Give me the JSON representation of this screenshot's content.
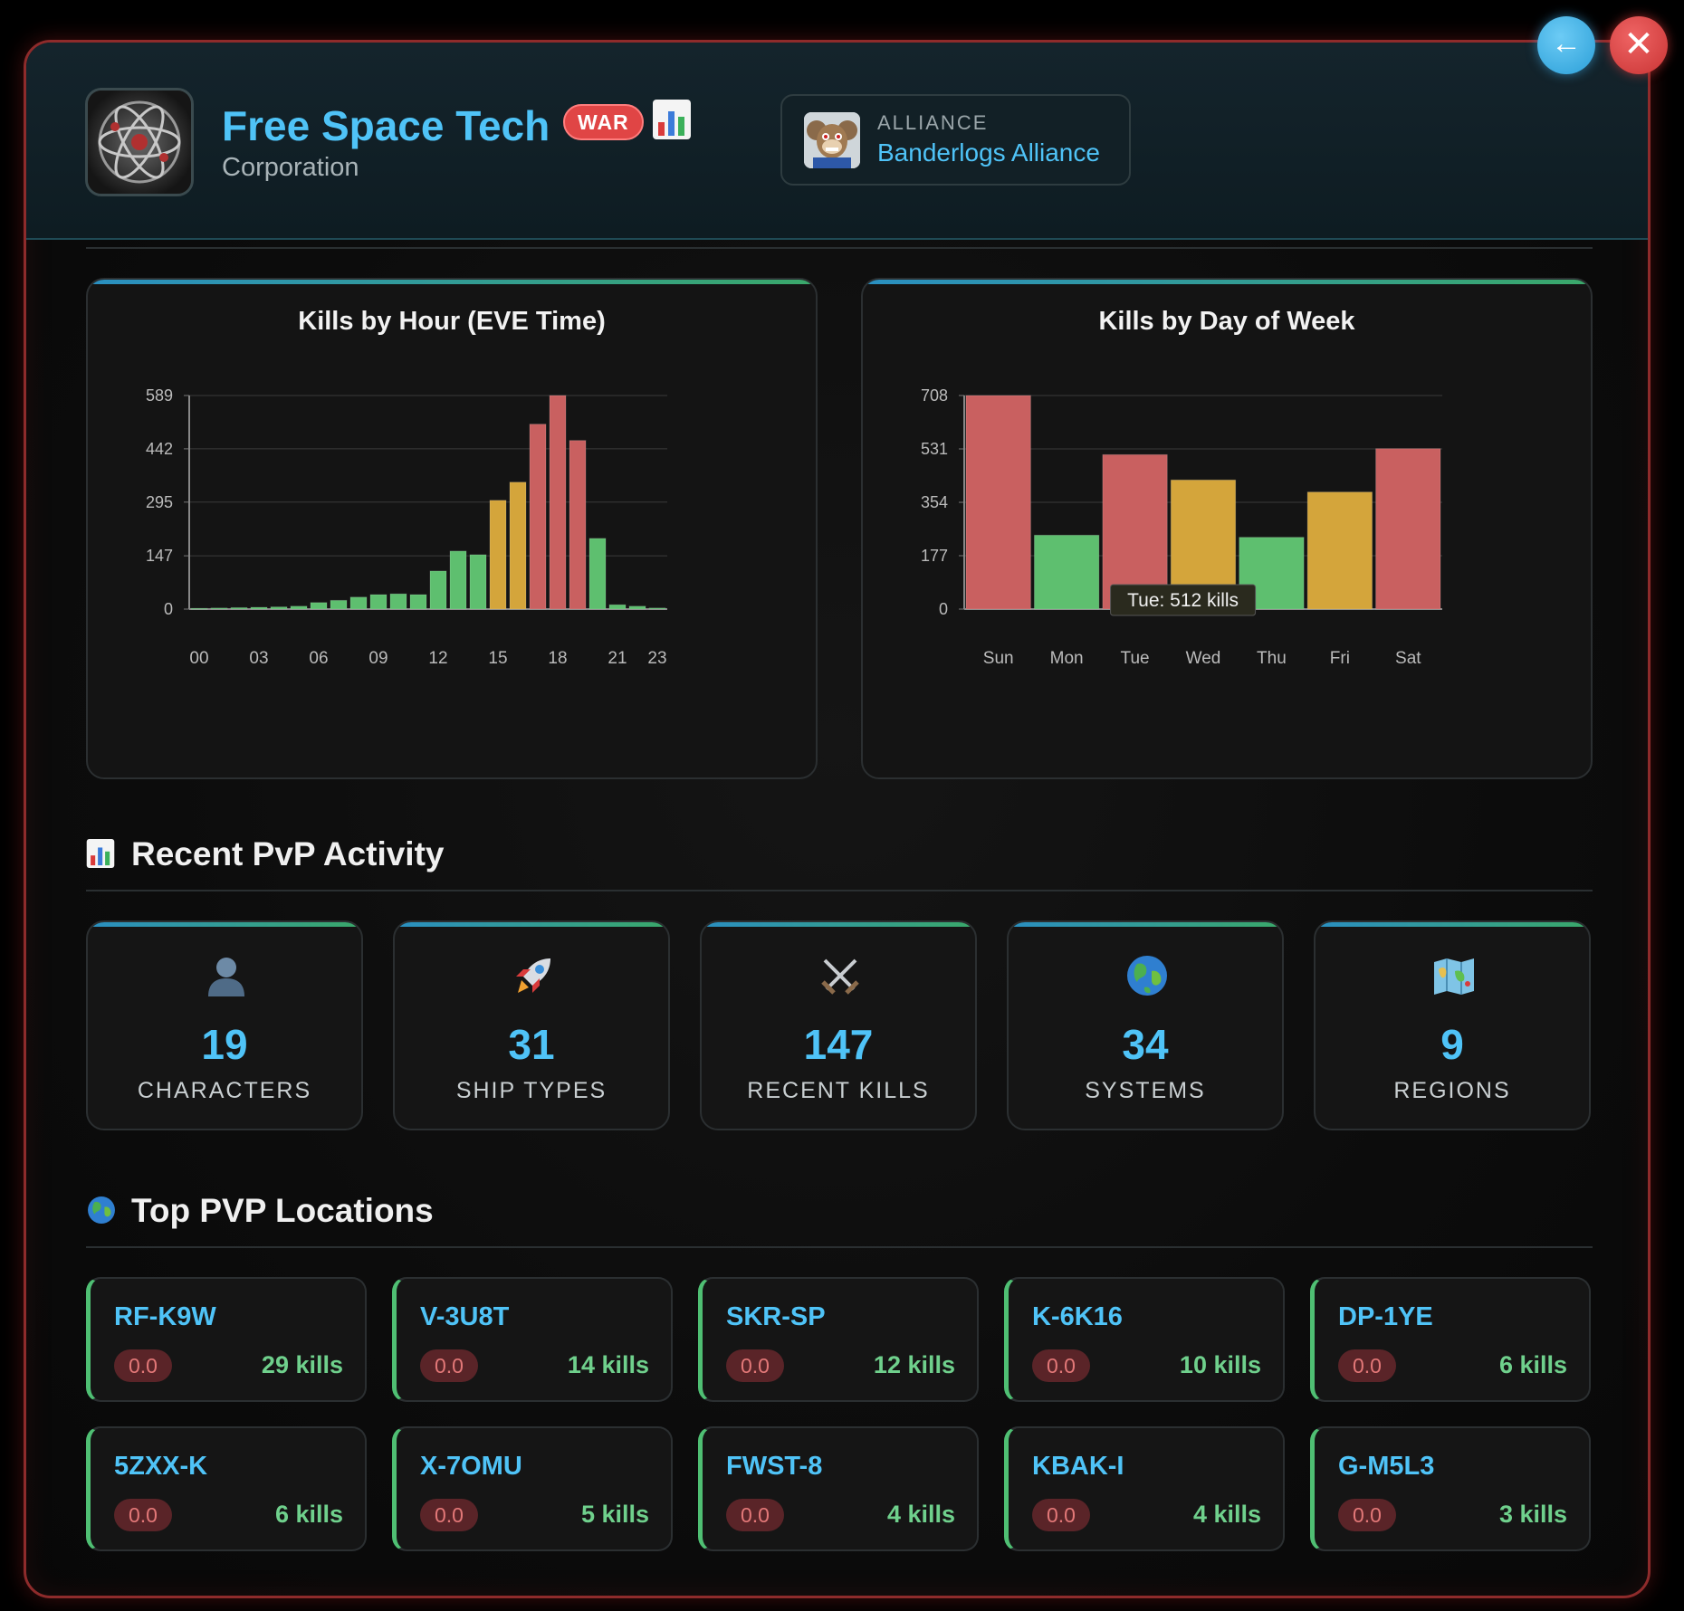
{
  "corporation": {
    "name": "Free Space Tech",
    "type": "Corporation",
    "war_badge": "WAR",
    "stats_icon": "bar-chart-icon"
  },
  "alliance": {
    "caption": "ALLIANCE",
    "name": "Banderlogs Alliance"
  },
  "buttons": {
    "back": "←",
    "close": "✕"
  },
  "colors": {
    "accent": "#4fc3f7",
    "low": "#5ebf6f",
    "mid": "#d4a53b",
    "high": "#c96060",
    "war": "#e04545"
  },
  "chart_data": [
    {
      "type": "bar",
      "title": "Kills by Hour (EVE Time)",
      "categories": [
        "00",
        "01",
        "02",
        "03",
        "04",
        "05",
        "06",
        "07",
        "08",
        "09",
        "10",
        "11",
        "12",
        "13",
        "14",
        "15",
        "16",
        "17",
        "18",
        "19",
        "20",
        "21",
        "22",
        "23"
      ],
      "values": [
        2,
        3,
        4,
        5,
        6,
        8,
        18,
        24,
        33,
        40,
        42,
        40,
        105,
        160,
        150,
        300,
        350,
        510,
        589,
        465,
        195,
        12,
        8,
        3
      ],
      "tick_labels": [
        "00",
        "03",
        "06",
        "09",
        "12",
        "15",
        "18",
        "21",
        "23"
      ],
      "y_ticks": [
        0,
        147,
        295,
        442,
        589
      ],
      "ylim": [
        0,
        589
      ],
      "grid": true
    },
    {
      "type": "bar",
      "title": "Kills by Day of Week",
      "categories": [
        "Sun",
        "Mon",
        "Tue",
        "Wed",
        "Thu",
        "Fri",
        "Sat"
      ],
      "values": [
        708,
        245,
        512,
        428,
        238,
        388,
        532
      ],
      "y_ticks": [
        0,
        177,
        354,
        531,
        708
      ],
      "ylim": [
        0,
        708
      ],
      "grid": true,
      "tooltip": "Tue: 512 kills"
    }
  ],
  "recent_activity": {
    "title": "Recent PvP Activity",
    "icon": "bar-chart-icon",
    "stats": [
      {
        "icon": "user-icon",
        "value": "19",
        "label": "CHARACTERS"
      },
      {
        "icon": "rocket-icon",
        "value": "31",
        "label": "SHIP TYPES"
      },
      {
        "icon": "crossed-swords-icon",
        "value": "147",
        "label": "RECENT KILLS"
      },
      {
        "icon": "globe-icon",
        "value": "34",
        "label": "SYSTEMS"
      },
      {
        "icon": "map-icon",
        "value": "9",
        "label": "REGIONS"
      }
    ]
  },
  "locations": {
    "title": "Top PVP Locations",
    "icon": "globe-icon",
    "items": [
      {
        "name": "RF-K9W",
        "security": "0.0",
        "kills": "29 kills"
      },
      {
        "name": "V-3U8T",
        "security": "0.0",
        "kills": "14 kills"
      },
      {
        "name": "SKR-SP",
        "security": "0.0",
        "kills": "12 kills"
      },
      {
        "name": "K-6K16",
        "security": "0.0",
        "kills": "10 kills"
      },
      {
        "name": "DP-1YE",
        "security": "0.0",
        "kills": "6 kills"
      },
      {
        "name": "5ZXX-K",
        "security": "0.0",
        "kills": "6 kills"
      },
      {
        "name": "X-7OMU",
        "security": "0.0",
        "kills": "5 kills"
      },
      {
        "name": "FWST-8",
        "security": "0.0",
        "kills": "4 kills"
      },
      {
        "name": "KBAK-I",
        "security": "0.0",
        "kills": "4 kills"
      },
      {
        "name": "G-M5L3",
        "security": "0.0",
        "kills": "3 kills"
      }
    ]
  }
}
